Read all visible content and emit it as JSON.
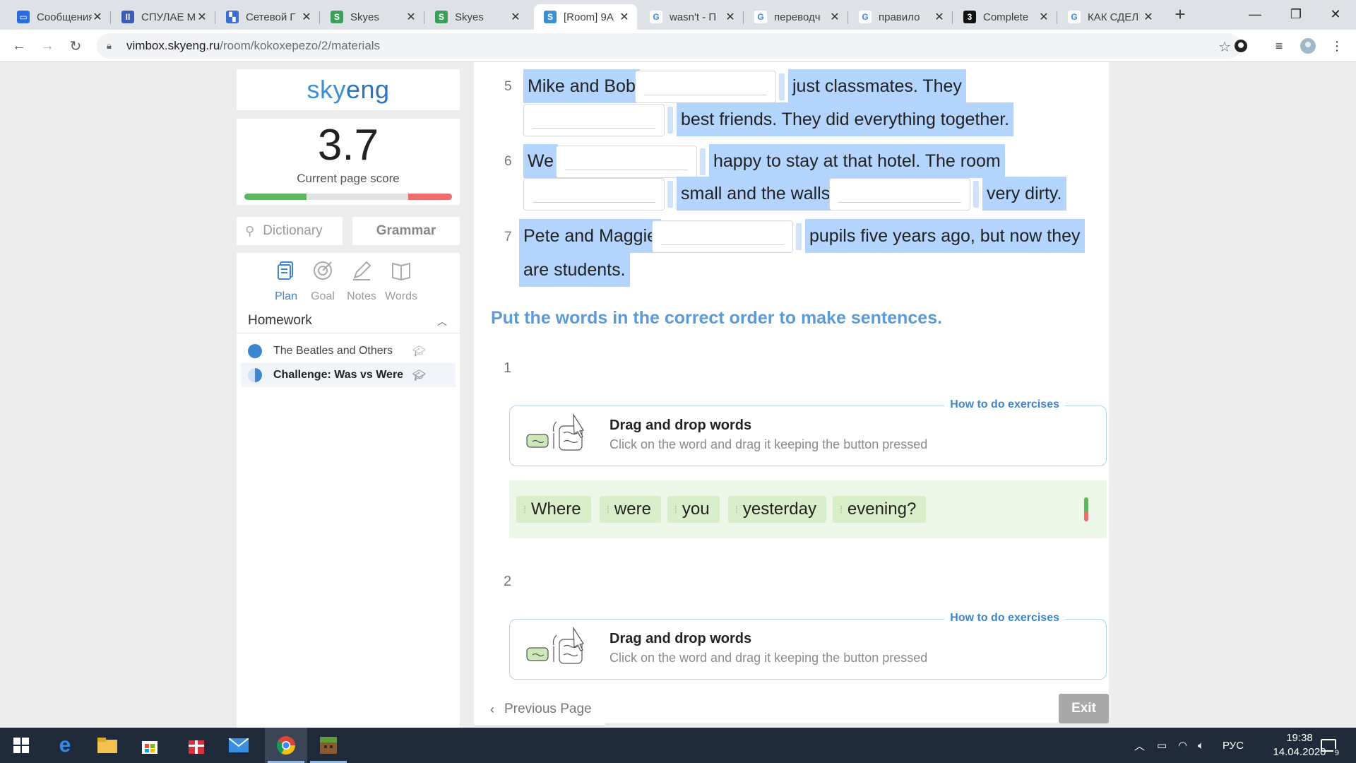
{
  "browser": {
    "tabs": [
      {
        "title": "Сообщения",
        "fav_color": "#2a6ce0",
        "fav_glyph": "▭"
      },
      {
        "title": "СПУЛАЕ М",
        "fav_color": "#3c5db5",
        "fav_glyph": "II"
      },
      {
        "title": "Сетевой Г",
        "fav_color": "#3a6fd1",
        "fav_glyph": "▚"
      },
      {
        "title": "Skyes",
        "fav_color": "#3b9f5a",
        "fav_glyph": "S"
      },
      {
        "title": "Skyes",
        "fav_color": "#3b9f5a",
        "fav_glyph": "S"
      },
      {
        "title": "[Room] 9A",
        "fav_color": "#3d8fd1",
        "fav_glyph": "S"
      },
      {
        "title": "wasn't - П",
        "fav_color": "#ffffff",
        "fav_glyph": "G"
      },
      {
        "title": "переводч",
        "fav_color": "#ffffff",
        "fav_glyph": "G"
      },
      {
        "title": "правило",
        "fav_color": "#ffffff",
        "fav_glyph": "G"
      },
      {
        "title": "Complete",
        "fav_color": "#111111",
        "fav_glyph": "3"
      },
      {
        "title": "КАК СДЕЛ",
        "fav_color": "#ffffff",
        "fav_glyph": "G"
      }
    ],
    "active_tab_index": 5,
    "new_tab_glyph": "+",
    "url_host": "vimbox.skyeng.ru",
    "url_path": "/room/kokoxepezo/2/materials",
    "window_controls": [
      "—",
      "❐",
      "✕"
    ]
  },
  "sidebar": {
    "logo_sky": "sky",
    "logo_eng": "eng",
    "score": {
      "value": "3.7",
      "label": "Current page score",
      "good_fraction": 0.3,
      "bad_fraction": 0.21
    },
    "dictionary_placeholder": "Dictionary",
    "grammar_label": "Grammar",
    "nav_tabs": [
      {
        "label": "Plan",
        "icon": "plan-icon",
        "active": true
      },
      {
        "label": "Goal",
        "icon": "goal-icon",
        "active": false
      },
      {
        "label": "Notes",
        "icon": "notes-icon",
        "active": false
      },
      {
        "label": "Words",
        "icon": "words-icon",
        "active": false
      }
    ],
    "section_title": "Homework",
    "lessons": [
      {
        "title": "The Beatles and Others",
        "progress": 1.0,
        "active": false
      },
      {
        "title": "Challenge: Was vs Were",
        "progress": 0.5,
        "active": true
      }
    ]
  },
  "exercise_fill": {
    "items": [
      {
        "num": "5",
        "parts": [
          "Mike and Bob",
          "just classmates. They",
          "best friends. They did everything together."
        ]
      },
      {
        "num": "6",
        "parts": [
          "We",
          "happy to stay at that hotel. The room",
          "small and the walls",
          "very dirty."
        ]
      },
      {
        "num": "7",
        "parts": [
          "Pete and Maggie",
          "pupils five years ago, but now they",
          "are students."
        ]
      }
    ]
  },
  "exercise_order": {
    "title": "Put the words in the correct order to make sentences.",
    "how_link": "How to do exercises",
    "info_title": "Drag and drop words",
    "info_desc": "Click on the word and drag it keeping the button pressed",
    "items": [
      {
        "num": "1",
        "words": [
          "Where",
          "were",
          "you",
          "yesterday",
          "evening?"
        ]
      },
      {
        "num": "2",
        "words": []
      }
    ]
  },
  "footer": {
    "prev_label": "Previous Page",
    "exit_label": "Exit"
  },
  "taskbar": {
    "lang": "РУС",
    "time": "19:38",
    "date": "14.04.2020",
    "notifications": "9"
  },
  "colors": {
    "accent": "#3c86cf",
    "selection": "#b3d4fc",
    "chip": "#d9efc9"
  }
}
